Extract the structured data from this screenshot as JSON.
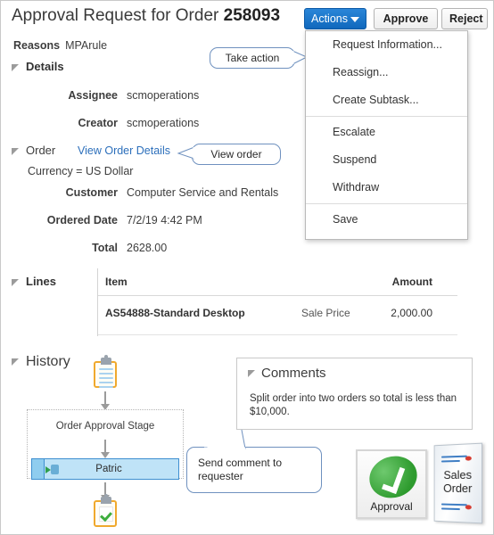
{
  "header": {
    "title_prefix": "Approval Request for Order ",
    "order_number": "258093",
    "actions_label": "Actions",
    "approve_label": "Approve",
    "reject_label": "Reject"
  },
  "actions_menu": {
    "items": [
      {
        "label": "Request Information..."
      },
      {
        "label": "Reassign..."
      },
      {
        "label": "Create Subtask..."
      },
      {
        "label": "Escalate"
      },
      {
        "label": "Suspend"
      },
      {
        "label": "Withdraw"
      },
      {
        "label": "Save"
      }
    ]
  },
  "reasons": {
    "label": "Reasons",
    "value": "MPArule"
  },
  "details": {
    "section_title": "Details",
    "assignee_label": "Assignee",
    "assignee_value": "scmoperations",
    "creator_label": "Creator",
    "creator_value": "scmoperations"
  },
  "order": {
    "section_title": "Order",
    "view_link": "View Order Details",
    "currency_line": "Currency = US Dollar",
    "customer_label": "Customer",
    "customer_value": "Computer Service and Rentals",
    "ordered_date_label": "Ordered Date",
    "ordered_date_value": "7/2/19 4:42 PM",
    "total_label": "Total",
    "total_value": "2628.00"
  },
  "lines": {
    "section_title": "Lines",
    "columns": {
      "item": "Item",
      "amount": "Amount"
    },
    "rows": [
      {
        "item": "AS54888-Standard Desktop",
        "price_type": "Sale Price",
        "amount": "2,000.00"
      }
    ]
  },
  "history": {
    "section_title": "History",
    "stage_label": "Order Approval Stage",
    "participant_name": "Patric"
  },
  "comments": {
    "section_title": "Comments",
    "body": "Split order  into two orders  so total is less than $10,000."
  },
  "callouts": {
    "take_action": "Take action",
    "view_order": "View order",
    "send_comment": "Send comment to requester"
  },
  "badges": {
    "approval_label": "Approval",
    "sales_order_label": "Sales\nOrder",
    "sales_order_line1": "Sales",
    "sales_order_line2": "Order"
  },
  "colors": {
    "accent_blue": "#1068bd",
    "link_blue": "#2c6fbb",
    "callout_border": "#6f91bf",
    "participant_fill": "#bfe3f7",
    "approval_green": "#2e9b2e",
    "clipboard_orange": "#f0a92e"
  }
}
